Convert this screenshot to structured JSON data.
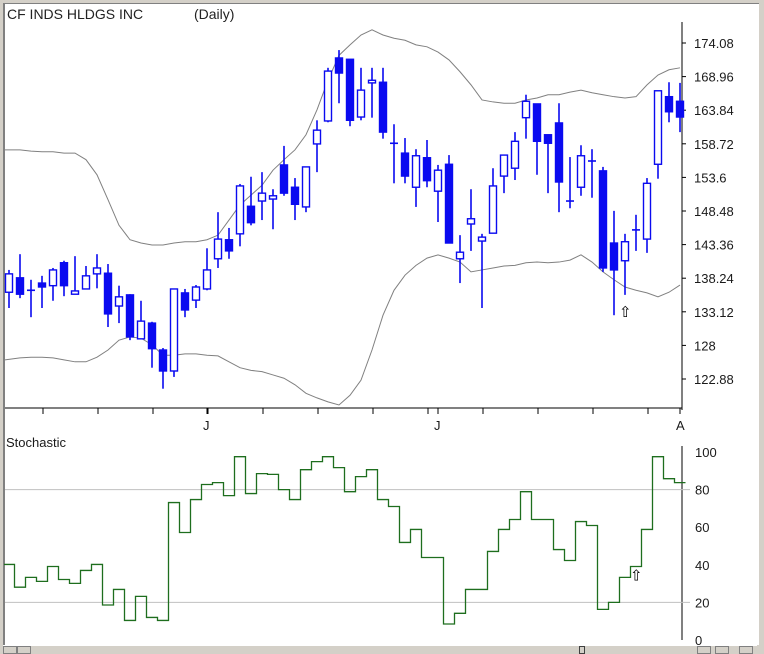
{
  "header": {
    "symbol": "CF INDS HLDGS INC",
    "period": "(Daily)"
  },
  "chart_data": [
    {
      "type": "candlestick",
      "title": "CF INDS HLDGS INC",
      "subtitle": "(Daily)",
      "ylim": [
        119,
        177
      ],
      "y_ticks": [
        "174.08",
        "168.96",
        "163.84",
        "158.72",
        "153.6",
        "148.48",
        "143.36",
        "138.24",
        "133.12",
        "128",
        "122.88"
      ],
      "x_month_labels": [
        {
          "label": "J",
          "index": 18
        },
        {
          "label": "J",
          "index": 39
        },
        {
          "label": "A",
          "index": 61
        }
      ],
      "ohlc_order": [
        "open",
        "high",
        "low",
        "close"
      ],
      "candles": [
        [
          136.1,
          139.5,
          133.7,
          138.9
        ],
        [
          138.3,
          141.9,
          135.2,
          135.8
        ],
        [
          136.4,
          138.0,
          132.3,
          136.4
        ],
        [
          137.5,
          138.6,
          133.7,
          136.9
        ],
        [
          137.1,
          139.8,
          134.8,
          139.5
        ],
        [
          140.6,
          140.9,
          135.5,
          137.1
        ],
        [
          135.8,
          141.6,
          135.8,
          136.3
        ],
        [
          136.6,
          140.1,
          136.6,
          138.6
        ],
        [
          138.9,
          141.9,
          136.7,
          139.8
        ],
        [
          139.0,
          140.4,
          130.8,
          132.8
        ],
        [
          134.0,
          137.1,
          131.4,
          135.4
        ],
        [
          135.7,
          135.8,
          128.8,
          129.3
        ],
        [
          129.0,
          134.8,
          129.0,
          131.7
        ],
        [
          131.4,
          131.6,
          124.6,
          127.5
        ],
        [
          127.3,
          127.6,
          121.4,
          124.1
        ],
        [
          124.1,
          136.6,
          123.2,
          136.6
        ],
        [
          136.0,
          136.6,
          132.3,
          133.4
        ],
        [
          134.9,
          137.2,
          133.7,
          136.9
        ],
        [
          136.6,
          142.8,
          136.4,
          139.5
        ],
        [
          141.2,
          148.3,
          139.8,
          144.2
        ],
        [
          144.1,
          145.9,
          141.2,
          142.4
        ],
        [
          145.0,
          152.6,
          143.1,
          152.3
        ],
        [
          149.2,
          153.7,
          146.3,
          146.7
        ],
        [
          150.0,
          154.4,
          147.1,
          151.2
        ],
        [
          150.3,
          151.8,
          145.7,
          150.8
        ],
        [
          155.5,
          158.4,
          150.8,
          151.2
        ],
        [
          152.1,
          153.5,
          147.1,
          149.5
        ],
        [
          149.1,
          155.2,
          148.3,
          155.2
        ],
        [
          158.7,
          162.3,
          154.4,
          160.8
        ],
        [
          162.2,
          170.3,
          162.0,
          169.8
        ],
        [
          171.8,
          173.0,
          164.9,
          169.5
        ],
        [
          171.6,
          171.6,
          161.4,
          162.3
        ],
        [
          162.8,
          170.3,
          162.3,
          166.9
        ],
        [
          168.0,
          170.3,
          162.7,
          168.4
        ],
        [
          168.1,
          170.3,
          159.5,
          160.5
        ],
        [
          158.8,
          161.7,
          152.7,
          158.8
        ],
        [
          157.3,
          159.6,
          152.7,
          153.8
        ],
        [
          152.1,
          157.9,
          149.1,
          156.9
        ],
        [
          156.6,
          159.3,
          152.1,
          153.1
        ],
        [
          151.5,
          155.5,
          146.8,
          154.7
        ],
        [
          155.6,
          157.0,
          143.6,
          143.6
        ],
        [
          141.2,
          144.8,
          137.5,
          142.2
        ],
        [
          146.5,
          151.8,
          142.4,
          147.3
        ],
        [
          143.9,
          145.0,
          133.7,
          144.5
        ],
        [
          145.1,
          155.0,
          145.1,
          152.3
        ],
        [
          153.8,
          157.0,
          151.2,
          157.0
        ],
        [
          155.0,
          160.5,
          153.2,
          159.1
        ],
        [
          162.7,
          166.2,
          159.5,
          165.2
        ],
        [
          164.8,
          164.8,
          154.0,
          159.1
        ],
        [
          160.1,
          160.1,
          151.2,
          158.8
        ],
        [
          161.9,
          164.9,
          148.3,
          152.9
        ],
        [
          150.0,
          156.7,
          148.9,
          150.0
        ],
        [
          152.1,
          158.5,
          150.8,
          156.9
        ],
        [
          156.1,
          157.9,
          150.5,
          156.1
        ],
        [
          154.6,
          155.2,
          139.2,
          139.8
        ],
        [
          143.6,
          148.5,
          132.6,
          139.5
        ],
        [
          140.9,
          145.0,
          135.7,
          143.8
        ],
        [
          145.6,
          147.9,
          142.4,
          145.6
        ],
        [
          144.2,
          153.5,
          142.1,
          152.7
        ],
        [
          155.6,
          166.8,
          153.4,
          166.8
        ],
        [
          165.9,
          168.1,
          162.0,
          163.6
        ],
        [
          165.2,
          168.0,
          160.5,
          162.8
        ]
      ],
      "bollinger_upper": [
        157.8,
        157.8,
        157.6,
        157.5,
        157.5,
        157.3,
        157.3,
        156.3,
        154.0,
        150.2,
        146.3,
        144.1,
        143.6,
        143.3,
        143.3,
        143.6,
        143.8,
        143.8,
        144.1,
        144.8,
        147.1,
        149.4,
        150.9,
        152.4,
        154.7,
        156.3,
        157.8,
        160.1,
        163.9,
        168.4,
        172.2,
        173.8,
        175.3,
        176.1,
        175.3,
        174.8,
        174.5,
        173.8,
        173.5,
        172.7,
        171.5,
        169.7,
        167.7,
        165.4,
        165.1,
        164.9,
        164.9,
        165.4,
        165.7,
        166.2,
        166.2,
        166.6,
        166.9,
        166.5,
        166.2,
        165.9,
        165.7,
        165.9,
        167.7,
        169.2,
        170.0,
        170.3
      ],
      "bollinger_lower": [
        125.8,
        126.1,
        126.2,
        126.2,
        126.1,
        125.8,
        125.5,
        125.5,
        126.2,
        127.3,
        128.8,
        129.3,
        129.1,
        128.1,
        126.5,
        126.5,
        126.7,
        126.7,
        126.5,
        126.4,
        125.5,
        124.6,
        124.2,
        124.0,
        123.5,
        123.0,
        122.0,
        120.7,
        120.0,
        119.4,
        118.9,
        120.4,
        122.7,
        127.3,
        132.6,
        136.4,
        138.7,
        140.2,
        141.3,
        141.8,
        141.3,
        140.7,
        139.2,
        139.5,
        139.8,
        140.1,
        140.2,
        140.6,
        140.7,
        140.6,
        140.7,
        141.0,
        141.8,
        140.7,
        139.2,
        138.0,
        136.9,
        136.4,
        136.0,
        135.4,
        136.1,
        137.2
      ],
      "signal_arrow_index": 56
    },
    {
      "type": "line",
      "title": "Stochastic",
      "ylim": [
        0,
        100
      ],
      "y_ticks": [
        "100",
        "80",
        "60",
        "40",
        "20",
        "0"
      ],
      "reference_lines": [
        80,
        20
      ],
      "values": [
        40.2,
        28.1,
        33.3,
        31.2,
        39.1,
        32.2,
        30.1,
        37.0,
        40.2,
        18.6,
        26.9,
        10.4,
        23.2,
        12.0,
        10.4,
        73.1,
        57.2,
        74.7,
        82.7,
        83.7,
        76.8,
        97.5,
        77.9,
        88.5,
        88.1,
        80.0,
        74.7,
        90.6,
        94.9,
        97.5,
        91.7,
        78.9,
        86.9,
        90.6,
        74.7,
        71.0,
        51.9,
        58.8,
        43.9,
        43.9,
        8.5,
        14.2,
        26.9,
        26.9,
        47.1,
        58.8,
        64.1,
        78.9,
        64.1,
        64.1,
        48.1,
        42.3,
        63.0,
        60.9,
        16.3,
        20.0,
        33.3,
        39.1,
        58.8,
        97.5,
        85.8,
        83.7
      ],
      "signal_arrow_index": 57
    }
  ],
  "colors": {
    "candle": "#0a0af0",
    "band": "#808080",
    "stochastic": "#1e6e1e",
    "grid": "#c0c0c0"
  },
  "icons": {
    "signal_arrow": "⇧"
  }
}
